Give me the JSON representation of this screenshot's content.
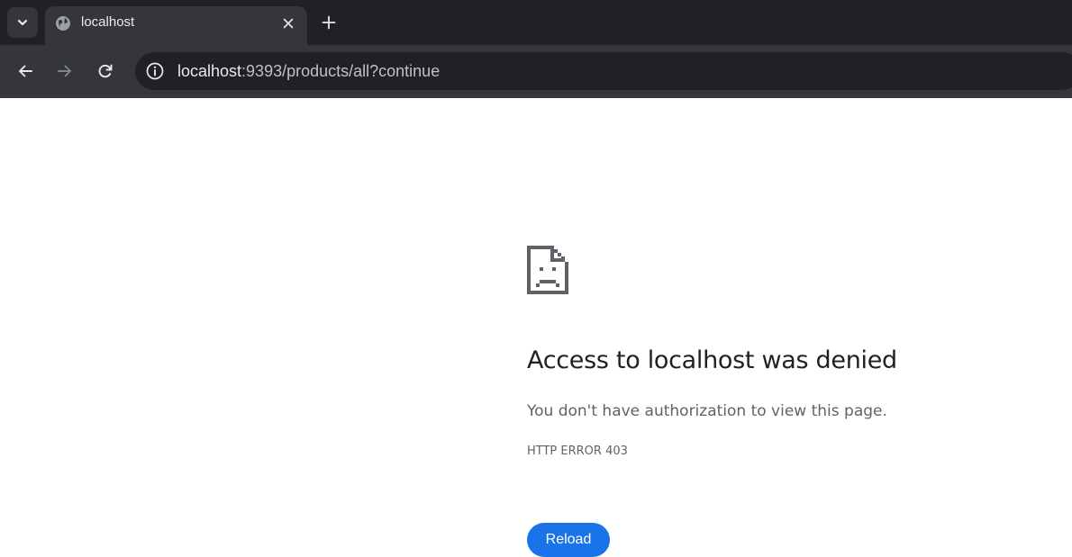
{
  "tabstrip": {
    "tab_title": "localhost"
  },
  "toolbar": {
    "url_host": "localhost",
    "url_rest": ":9393/products/all?continue"
  },
  "error": {
    "heading": "Access to localhost was denied",
    "description": "You don't have authorization to view this page.",
    "code": "HTTP ERROR 403",
    "reload_label": "Reload"
  },
  "icons": {
    "tab_search": "chevron-down-icon",
    "favicon": "globe-icon",
    "tab_close": "close-icon",
    "new_tab": "plus-icon",
    "back": "arrow-left-icon",
    "forward": "arrow-right-icon",
    "reload": "reload-icon",
    "site_info": "info-icon",
    "error": "sad-document-icon"
  },
  "colors": {
    "reload_button": "#1a73e8",
    "heading_text": "#202124",
    "secondary_text": "#5f6368"
  }
}
